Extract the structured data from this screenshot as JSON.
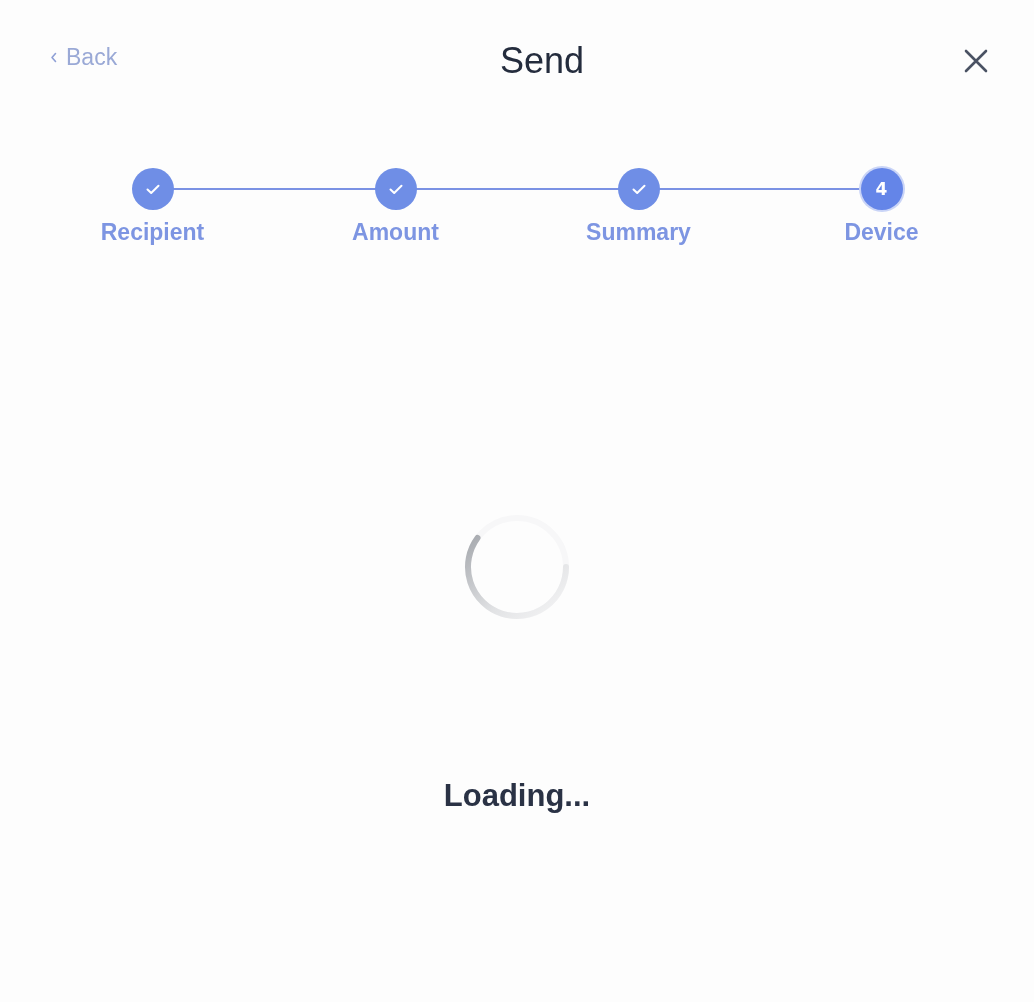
{
  "header": {
    "back": "Back",
    "title": "Send"
  },
  "steps": [
    {
      "label": "Recipient",
      "completed": true
    },
    {
      "label": "Amount",
      "completed": true
    },
    {
      "label": "Summary",
      "completed": true
    },
    {
      "label": "Device",
      "completed": false,
      "number": "4"
    }
  ],
  "status": {
    "text": "Loading..."
  }
}
